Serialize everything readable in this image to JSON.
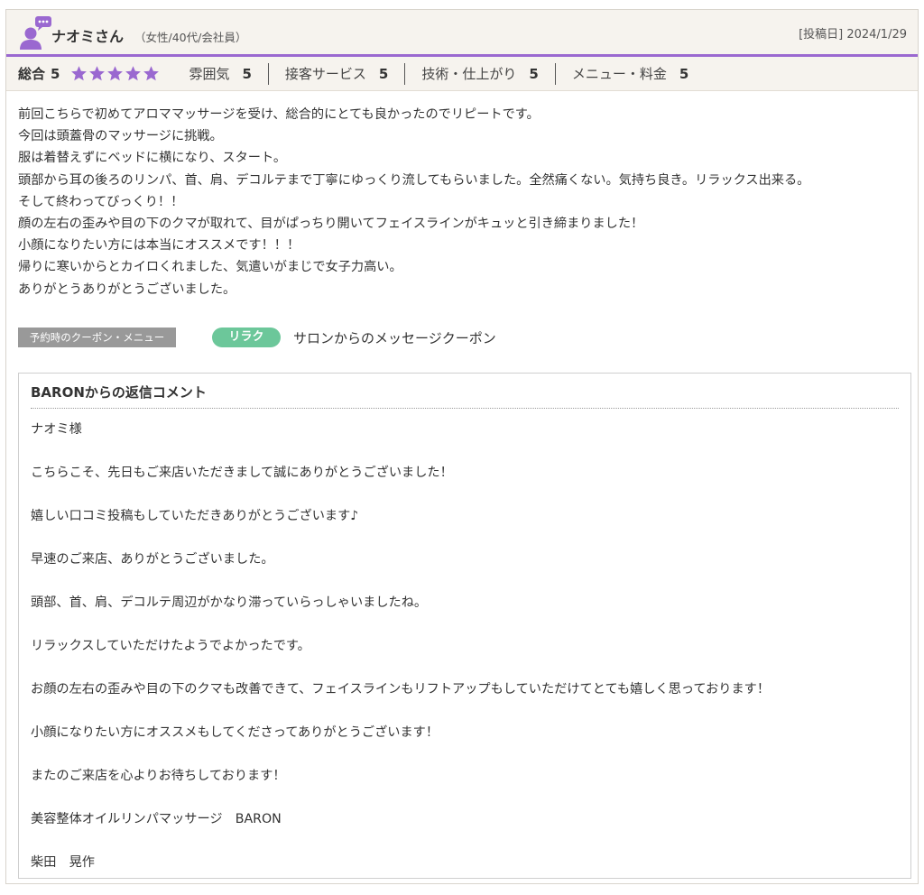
{
  "header": {
    "reviewer_name": "ナオミさん",
    "reviewer_meta": "（女性/40代/会社員）",
    "post_date": "[投稿日] 2024/1/29",
    "avatar_icon": "user-chat-icon",
    "accent_color": "#9a68d0"
  },
  "rating": {
    "overall_label": "総合",
    "overall_score": "5",
    "stars_filled": 5,
    "stars_total": 5,
    "star_color": "#9a68d0",
    "categories": [
      {
        "label": "雰囲気",
        "score": "5"
      },
      {
        "label": "接客サービス",
        "score": "5"
      },
      {
        "label": "技術・仕上がり",
        "score": "5"
      },
      {
        "label": "メニュー・料金",
        "score": "5"
      }
    ]
  },
  "review": {
    "lines": [
      "前回こちらで初めてアロママッサージを受け、総合的にとても良かったのでリピートです。",
      "今回は頭蓋骨のマッサージに挑戦。",
      "服は着替えずにベッドに横になり、スタート。",
      "頭部から耳の後ろのリンパ、首、肩、デコルテまで丁寧にゆっくり流してもらいました。全然痛くない。気持ち良き。リラックス出来る。",
      "そして終わってびっくり！！",
      "顔の左右の歪みや目の下のクマが取れて、目がぱっちり開いてフェイスラインがキュッと引き締まりました！",
      "小顔になりたい方には本当にオススメです！！！",
      "帰りに寒いからとカイロくれました、気遣いがまじで女子力高い。",
      "ありがとうありがとうございました。"
    ]
  },
  "coupon": {
    "label": "予約時のクーポン・メニュー",
    "tag": "リラク",
    "tag_color": "#6cc79a",
    "name": "サロンからのメッセージクーポン"
  },
  "reply": {
    "title": "BARONからの返信コメント",
    "lines": [
      "ナオミ様",
      "こちらこそ、先日もご来店いただきまして誠にありがとうございました！",
      "嬉しい口コミ投稿もしていただきありがとうございます♪",
      "早速のご来店、ありがとうございました。",
      "頭部、首、肩、デコルテ周辺がかなり滞っていらっしゃいましたね。",
      "リラックスしていただけたようでよかったです。",
      "お顔の左右の歪みや目の下のクマも改善できて、フェイスラインもリフトアップもしていただけてとても嬉しく思っております！",
      "小顔になりたい方にオススメもしてくださってありがとうございます！",
      "またのご来店を心よりお待ちしております！",
      "美容整体オイルリンパマッサージ　BARON",
      "柴田　晃作"
    ]
  }
}
